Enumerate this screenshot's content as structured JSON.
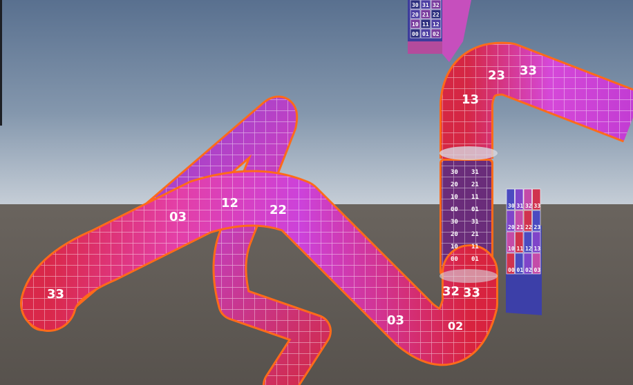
{
  "scene": {
    "colors": {
      "sky_top": "#5a7393",
      "sky_horizon": "#c3ccd5",
      "ground": "#5f5953",
      "outline": "#ff6a1a",
      "tube_magenta": "#d23fd2",
      "tube_red": "#d8233f",
      "tube_purple": "#7a3fcf"
    },
    "texture_grid": {
      "rows": [
        [
          "30",
          "31",
          "32",
          "33"
        ],
        [
          "20",
          "21",
          "22",
          "23"
        ],
        [
          "10",
          "11",
          "12",
          "13"
        ],
        [
          "00",
          "01",
          "02",
          "03"
        ]
      ]
    },
    "top_card": {
      "rows": [
        [
          "30",
          "31",
          "32"
        ],
        [
          "20",
          "21",
          "22"
        ],
        [
          "10",
          "11",
          "12"
        ],
        [
          "00",
          "01",
          "02"
        ]
      ]
    },
    "tube_labels": [
      "13",
      "23",
      "33",
      "03",
      "32",
      "12",
      "22",
      "02"
    ]
  }
}
